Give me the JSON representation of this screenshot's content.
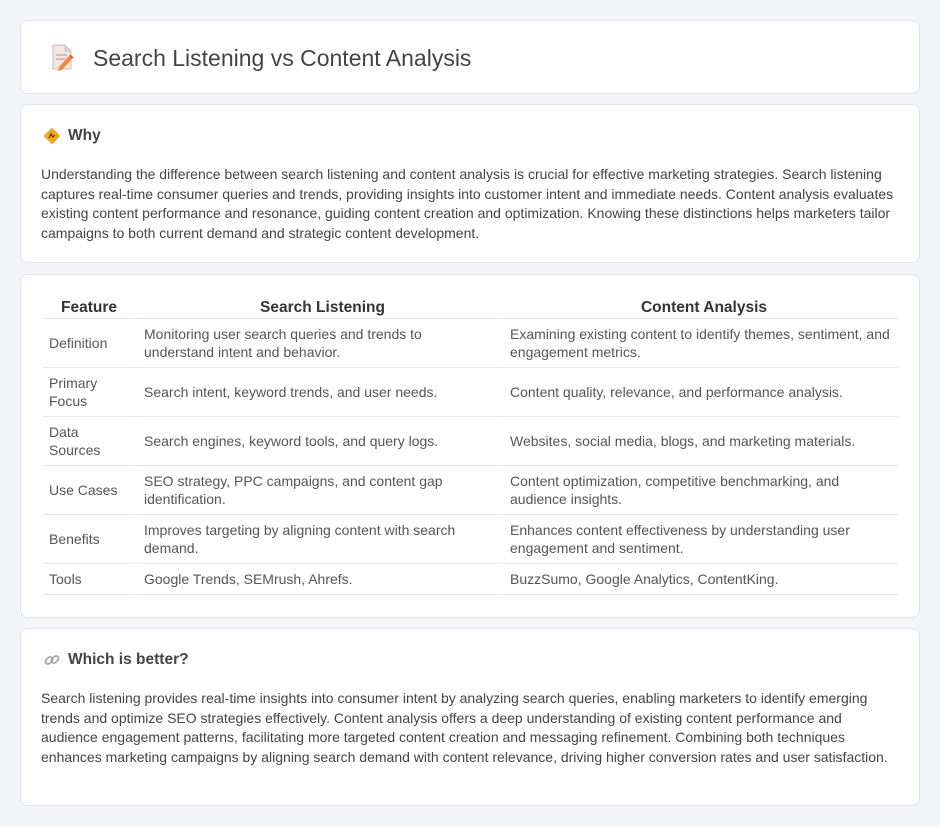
{
  "header": {
    "title": "Search Listening vs Content Analysis",
    "icon": "document-pencil-icon"
  },
  "why": {
    "title": "Why",
    "icon": "diamond-sign-icon",
    "text": "Understanding the difference between search listening and content analysis is crucial for effective marketing strategies. Search listening captures real-time consumer queries and trends, providing insights into customer intent and immediate needs. Content analysis evaluates existing content performance and resonance, guiding content creation and optimization. Knowing these distinctions helps marketers tailor campaigns to both current demand and strategic content development."
  },
  "table": {
    "headers": [
      "Feature",
      "Search Listening",
      "Content Analysis"
    ],
    "rows": [
      [
        "Definition",
        "Monitoring user search queries and trends to understand intent and behavior.",
        "Examining existing content to identify themes, sentiment, and engagement metrics."
      ],
      [
        "Primary Focus",
        "Search intent, keyword trends, and user needs.",
        "Content quality, relevance, and performance analysis."
      ],
      [
        "Data Sources",
        "Search engines, keyword tools, and query logs.",
        "Websites, social media, blogs, and marketing materials."
      ],
      [
        "Use Cases",
        "SEO strategy, PPC campaigns, and content gap identification.",
        "Content optimization, competitive benchmarking, and audience insights."
      ],
      [
        "Benefits",
        "Improves targeting by aligning content with search demand.",
        "Enhances content effectiveness by understanding user engagement and sentiment."
      ],
      [
        "Tools",
        "Google Trends, SEMrush, Ahrefs.",
        "BuzzSumo, Google Analytics, ContentKing."
      ]
    ]
  },
  "better": {
    "title": "Which is better?",
    "icon": "link-icon",
    "text": "Search listening provides real-time insights into consumer intent by analyzing search queries, enabling marketers to identify emerging trends and optimize SEO strategies effectively. Content analysis offers a deep understanding of existing content performance and audience engagement patterns, facilitating more targeted content creation and messaging refinement. Combining both techniques enhances marketing campaigns by aligning search demand with content relevance, driving higher conversion rates and user satisfaction."
  }
}
